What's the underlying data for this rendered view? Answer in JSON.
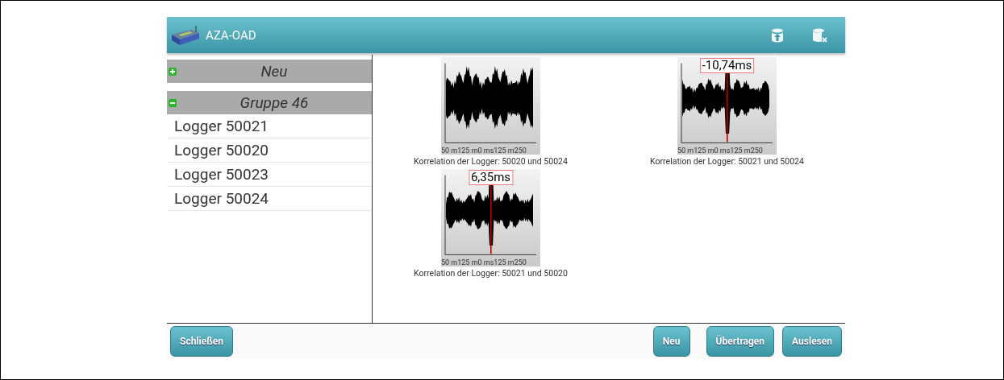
{
  "window": {
    "title": "AZA-OAD"
  },
  "sidebar": {
    "items": [
      {
        "kind": "header",
        "label": "Neu",
        "expanded": false
      },
      {
        "kind": "header",
        "label": "Gruppe 46",
        "expanded": true
      },
      {
        "kind": "item",
        "label": "Logger 50021"
      },
      {
        "kind": "item",
        "label": "Logger 50020"
      },
      {
        "kind": "item",
        "label": "Logger 50023"
      },
      {
        "kind": "item",
        "label": "Logger 50024"
      }
    ]
  },
  "correlations": [
    {
      "axis": "50 m125 m0 ms125 m250",
      "caption": "Korrelation der Logger: 50020 und 50024"
    },
    {
      "axis": "50 m125 m0 ms125 m250",
      "marker": "-10,74ms",
      "caption": "Korrelation der Logger: 50021 und 50024"
    },
    {
      "axis": "50 m125 m0 ms125 m250",
      "marker": "6,35ms",
      "caption": "Korrelation der Logger: 50021 und 50020"
    }
  ],
  "buttons": {
    "left": [
      "Schließen"
    ],
    "right": [
      "Neu",
      "Übertragen",
      "Auslesen"
    ]
  }
}
